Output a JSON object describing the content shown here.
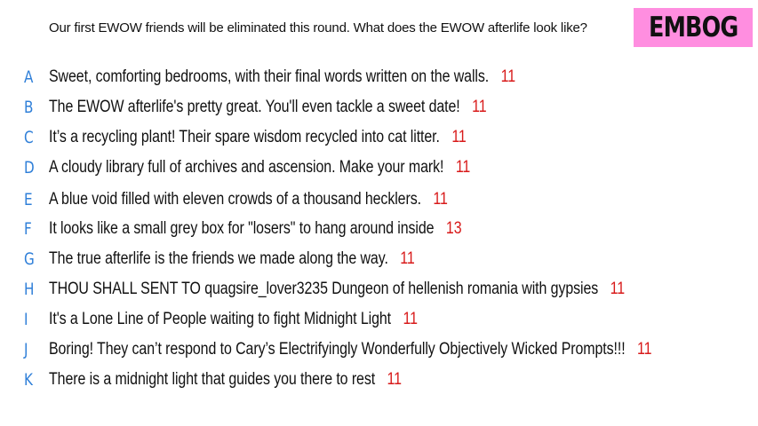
{
  "prompt": "Our first EWOW friends will be eliminated this round. What does the EWOW afterlife look like?",
  "logo": "EMBOG",
  "colors": {
    "letter": "#2f7fd8",
    "count": "#d81a1a",
    "logo_bg": "#ff8ee0"
  },
  "responses": [
    {
      "letter": "A",
      "text": "Sweet, comforting bedrooms, with their final words written on the walls.",
      "count": "11"
    },
    {
      "letter": "B",
      "text": "The EWOW afterlife's pretty great. You'll even tackle a sweet date!",
      "count": "11"
    },
    {
      "letter": "C",
      "text": "It’s a recycling plant! Their spare wisdom recycled into cat litter.",
      "count": "11"
    },
    {
      "letter": "D",
      "text": "A cloudy library full of archives and ascension. Make your mark!",
      "count": "11"
    },
    {
      "letter": "E",
      "text": "A blue void filled with eleven crowds of a thousand hecklers.",
      "count": "11"
    },
    {
      "letter": "F",
      "text": "It looks like a small grey box for \"losers\" to hang around inside",
      "count": "13"
    },
    {
      "letter": "G",
      "text": "The true afterlife is the friends we made along the way.",
      "count": "11"
    },
    {
      "letter": "H",
      "text": "THOU SHALL SENT TO quagsire_lover3235 Dungeon of hellenish romania with gypsies",
      "count": "11"
    },
    {
      "letter": "I",
      "text": "It's a Lone Line of People waiting to fight Midnight Light",
      "count": "11"
    },
    {
      "letter": "J",
      "text": "Boring! They can’t respond to Cary’s Electrifyingly Wonderfully Objectively Wicked Prompts!!!",
      "count": "11"
    },
    {
      "letter": "K",
      "text": "There is a midnight light that guides you there to rest",
      "count": "11"
    }
  ]
}
